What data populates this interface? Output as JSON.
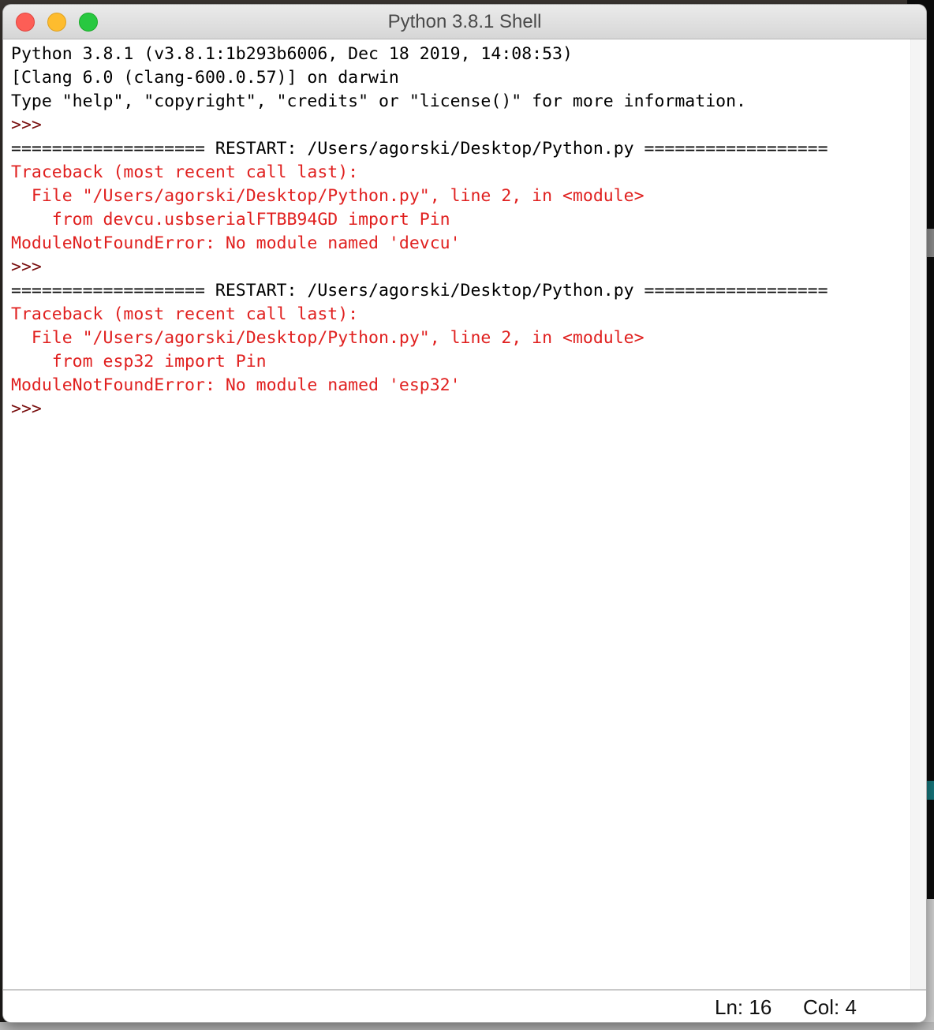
{
  "window": {
    "title": "Python 3.8.1 Shell",
    "buttons": [
      "close",
      "minimize",
      "zoom"
    ]
  },
  "colors": {
    "error_text": "#e0201f",
    "prompt": "#7a1010",
    "normal_text": "#000000",
    "close": "#fd5e56",
    "minimize": "#febc2e",
    "zoom": "#28c840"
  },
  "shell": {
    "lines": [
      {
        "type": "normal",
        "text": "Python 3.8.1 (v3.8.1:1b293b6006, Dec 18 2019, 14:08:53)"
      },
      {
        "type": "normal",
        "text": "[Clang 6.0 (clang-600.0.57)] on darwin"
      },
      {
        "type": "normal",
        "text": "Type \"help\", \"copyright\", \"credits\" or \"license()\" for more information."
      },
      {
        "type": "prompt",
        "text": ">>>"
      },
      {
        "type": "normal",
        "text": "=================== RESTART: /Users/agorski/Desktop/Python.py =================="
      },
      {
        "type": "error",
        "text": "Traceback (most recent call last):"
      },
      {
        "type": "error",
        "text": "  File \"/Users/agorski/Desktop/Python.py\", line 2, in <module>"
      },
      {
        "type": "error",
        "text": "    from devcu.usbserialFTBB94GD import Pin"
      },
      {
        "type": "error",
        "text": "ModuleNotFoundError: No module named 'devcu'"
      },
      {
        "type": "prompt",
        "text": ">>>"
      },
      {
        "type": "normal",
        "text": "=================== RESTART: /Users/agorski/Desktop/Python.py =================="
      },
      {
        "type": "error",
        "text": "Traceback (most recent call last):"
      },
      {
        "type": "error",
        "text": "  File \"/Users/agorski/Desktop/Python.py\", line 2, in <module>"
      },
      {
        "type": "error",
        "text": "    from esp32 import Pin"
      },
      {
        "type": "error",
        "text": "ModuleNotFoundError: No module named 'esp32'"
      },
      {
        "type": "prompt",
        "text": ">>> "
      }
    ]
  },
  "statusbar": {
    "ln": "Ln: 16",
    "col": "Col: 4"
  }
}
